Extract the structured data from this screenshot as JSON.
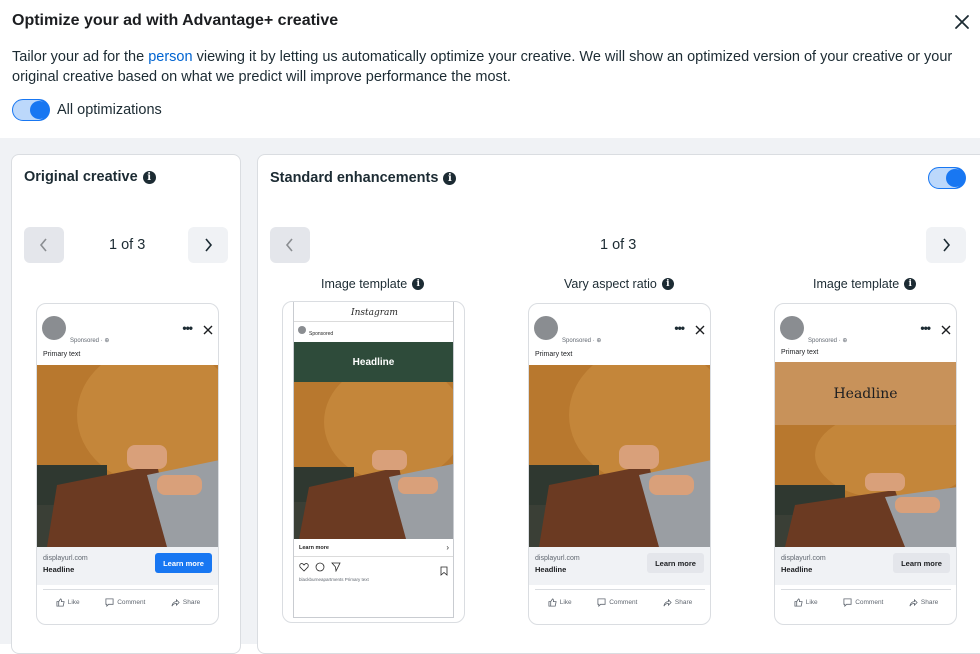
{
  "dialog": {
    "title": "Optimize your ad with Advantage+ creative",
    "description_before": "Tailor your ad for the ",
    "description_link": "person",
    "description_after": " viewing it by letting us automatically optimize your creative. We will show an optimized version of your creative or your original creative based on what we predict will improve performance the most.",
    "all_optimizations_label": "All optimizations",
    "all_optimizations_on": true
  },
  "original": {
    "title": "Original creative",
    "pager": "1 of 3"
  },
  "standard": {
    "title": "Standard enhancements",
    "pager": "1 of 3",
    "toggle_on": true,
    "variants": [
      {
        "label": "Image template"
      },
      {
        "label": "Vary aspect ratio"
      },
      {
        "label": "Image template"
      }
    ]
  },
  "ad": {
    "sponsored": "Sponsored · ⊕",
    "primary_text": "Primary text",
    "domain": "displayurl.com",
    "headline": "Headline",
    "cta": "Learn more",
    "like": "Like",
    "comment": "Comment",
    "share": "Share"
  },
  "instagram": {
    "logo": "Instagram",
    "sponsored": "Sponsored",
    "headline": "Headline",
    "learn_more": "Learn more",
    "caption": "blackburneapartments Primary text"
  },
  "template_headline": "Headline",
  "colors": {
    "accent": "#1877f2",
    "green_template": "#2e4b3a",
    "tan_template": "#c8925a"
  }
}
